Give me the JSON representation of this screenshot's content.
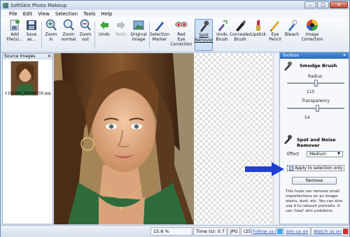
{
  "window": {
    "title": "SoftSkin Photo Makeup"
  },
  "menu": [
    "File",
    "Edit",
    "View",
    "Selection",
    "Tools",
    "Help"
  ],
  "toolbar": {
    "tools": [
      {
        "id": "add-files",
        "label": "Add\nFile(s)...",
        "icon": "add-files-icon"
      },
      {
        "id": "save-as",
        "label": "Save\nas...",
        "icon": "save-icon"
      },
      {
        "id": "zoom-in",
        "label": "Zoom\nin",
        "icon": "zoom-in-icon"
      },
      {
        "id": "zoom-normal",
        "label": "Zoom\nnormal",
        "icon": "zoom-normal-icon"
      },
      {
        "id": "zoom-out",
        "label": "Zoom\nout",
        "icon": "zoom-out-icon"
      },
      {
        "id": "undo",
        "label": "Undo",
        "icon": "undo-arrow-icon"
      },
      {
        "id": "redo",
        "label": "Redo",
        "icon": "redo-arrow-icon",
        "disabled": true
      },
      {
        "id": "original-image",
        "label": "Original\nImage",
        "icon": "image-icon"
      },
      {
        "id": "selection-marker",
        "label": "Selection\nMarker",
        "icon": "marker-pen-icon"
      },
      {
        "id": "red-eye",
        "label": "Red\nEye\nCorrection",
        "icon": "red-eye-icon"
      },
      {
        "id": "spot-remover",
        "label": "Spot\nRemover",
        "icon": "spot-brush-icon",
        "active": true
      },
      {
        "id": "undo-brush",
        "label": "Undo\nBrush",
        "icon": "undo-brush-icon"
      },
      {
        "id": "concealer-brush",
        "label": "Concealer\nBrush",
        "icon": "concealer-brush-icon"
      },
      {
        "id": "lipstick",
        "label": "Lipstick",
        "icon": "lipstick-icon"
      },
      {
        "id": "eye-pencil",
        "label": "Eye\nPencil",
        "icon": "eye-pencil-icon"
      },
      {
        "id": "bleach",
        "label": "Bleach",
        "icon": "bleach-brush-icon"
      },
      {
        "id": "image-correction",
        "label": "Image\nCorrection",
        "icon": "color-wheel-icon"
      }
    ]
  },
  "left_panel": {
    "title": "Source Images",
    "thumb_caption": "1192462_85066716.jpg"
  },
  "toolbox": {
    "title": "Toolbox",
    "smudge": {
      "title": "Smudge Brush",
      "radius_label": "Radius",
      "radius_value": "115",
      "radius_fraction": 0.52,
      "transparency_label": "Transparency",
      "transparency_value": "54",
      "transparency_fraction": 0.54
    },
    "spot": {
      "title": "Spot and Noise Remover",
      "effect_label": "Effect",
      "effect_value": "Medium",
      "apply_label": "Apply to selection only",
      "apply_checked": "✓",
      "remove_button": "Remove",
      "description": "This tools can remove small imperfections on an image: stains, dust, etc. You can also use it to retouch portraits. It can 'heal' skin problems."
    }
  },
  "status": {
    "zoom": "15.6 %",
    "time": "Time (s): 0.7",
    "format": "JPG",
    "size": "(2592x",
    "follow": "Follow us on",
    "join": "Join us on",
    "watch": "Watch us on"
  },
  "colors": {
    "accent": "#2f6ab8",
    "arrow": "#1f3fd1",
    "link": "#1b4fb3"
  }
}
